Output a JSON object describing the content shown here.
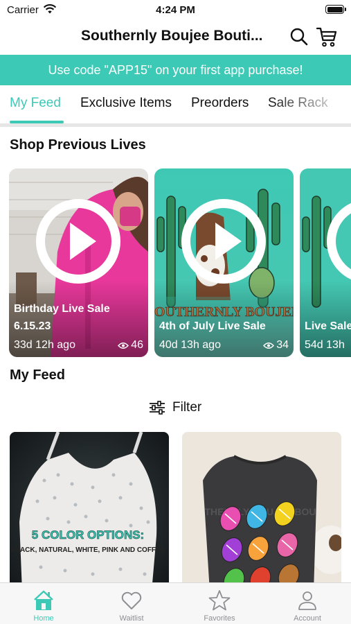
{
  "status_bar": {
    "carrier": "Carrier",
    "time": "4:24 PM"
  },
  "header": {
    "title": "Southernly Boujee Bouti..."
  },
  "promo": {
    "text": "Use code \"APP15\" on your first app purchase!"
  },
  "tabs": [
    {
      "label": "My Feed",
      "active": true
    },
    {
      "label": "Exclusive Items",
      "active": false
    },
    {
      "label": "Preorders",
      "active": false
    },
    {
      "label": "Sale Rack",
      "active": false
    }
  ],
  "previous_lives": {
    "title": "Shop Previous Lives",
    "items": [
      {
        "title": "Birthday Live Sale 6.15.23",
        "ago": "33d 12h ago",
        "views": "46"
      },
      {
        "title": "4th of July Live Sale",
        "ago": "40d 13h ago",
        "views": "34"
      },
      {
        "title": "Live Sale",
        "ago": "54d 13h"
      }
    ]
  },
  "feed": {
    "title": "My Feed",
    "filter_label": "Filter",
    "products": [
      {
        "overlay_heading": "5 COLOR OPTIONS:",
        "overlay_sub": "BLACK, NATURAL, WHITE, PINK AND COFFEE"
      },
      {
        "shirt_text": "THERNLY BOUJEE BOU"
      }
    ]
  },
  "tab_bar": [
    {
      "label": "Home",
      "icon": "home-icon",
      "active": true
    },
    {
      "label": "Waitlist",
      "icon": "heart-icon",
      "active": false
    },
    {
      "label": "Favorites",
      "icon": "star-icon",
      "active": false
    },
    {
      "label": "Account",
      "icon": "person-icon",
      "active": false
    }
  ],
  "colors": {
    "accent": "#3cc9b5",
    "inactive": "#8e8e93",
    "divider": "#e6e6e6"
  }
}
